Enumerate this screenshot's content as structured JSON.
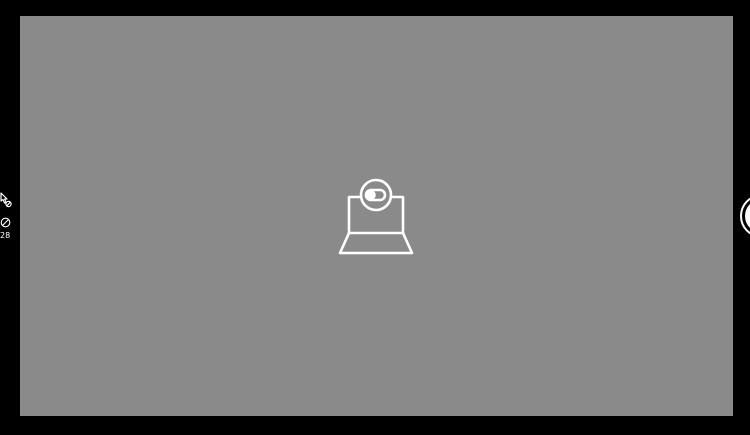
{
  "screen": {
    "background_color": "#000000",
    "viewfinder_color": "#8a8a8b",
    "foreground_color": "#ffffff"
  },
  "center_icon": {
    "name": "camera-off-icon"
  },
  "left_rail": {
    "icons": [
      "pointer-icon",
      "timer-icon"
    ],
    "count_label": "28"
  },
  "shutter": {
    "name": "shutter-button"
  }
}
